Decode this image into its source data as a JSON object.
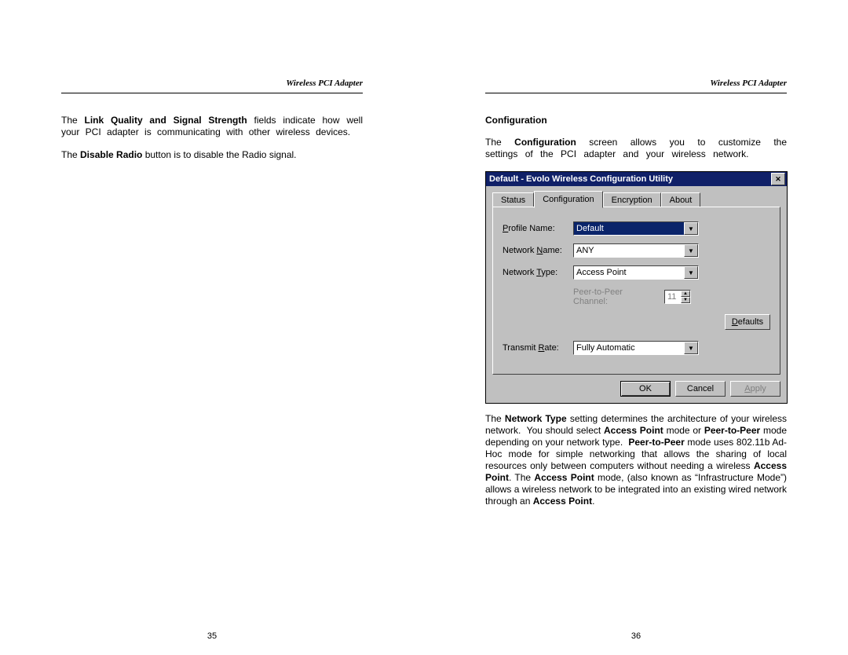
{
  "header": {
    "title": "Wireless PCI Adapter"
  },
  "left_page": {
    "number": "35",
    "para1_prefix": "The ",
    "para1_bold": "Link Quality and Signal Strength",
    "para1_suffix": " fields indicate how well your PCI adapter is communicating with other wireless devices.",
    "para2_prefix": "The ",
    "para2_bold": "Disable Radio",
    "para2_suffix": " button is to disable the Radio signal."
  },
  "right_page": {
    "number": "36",
    "section_heading": "Configuration",
    "intro": "The Configuration screen allows you to customize the settings of the PCI adapter and your wireless network.",
    "body_para": "The Network Type setting determines the architecture of your wireless network.  You should select Access Point mode or Peer-to-Peer mode depending on your network type.  Peer-to-Peer mode uses 802.11b Ad-Hoc mode for simple networking that allows the sharing of local resources only between computers without needing a wireless Access Point.  The Access Point mode, (also known as “Infrastructure Mode”) allows a wireless network to be integrated into an existing wired network through an Access Point."
  },
  "dialog": {
    "title": "Default - Evolo Wireless Configuration Utility",
    "tabs": {
      "status": "Status",
      "configuration": "Configuration",
      "encryption": "Encryption",
      "about": "About"
    },
    "labels": {
      "profile_name": "Profile Name:",
      "network_name": "Network Name:",
      "network_type": "Network Type:",
      "p2p_channel": "Peer-to-Peer Channel:",
      "transmit_rate": "Transmit Rate:"
    },
    "values": {
      "profile_name": "Default",
      "network_name": "ANY",
      "network_type": "Access Point",
      "p2p_channel": "11",
      "transmit_rate": "Fully Automatic"
    },
    "buttons": {
      "defaults": "Defaults",
      "ok": "OK",
      "cancel": "Cancel",
      "apply": "Apply"
    }
  }
}
